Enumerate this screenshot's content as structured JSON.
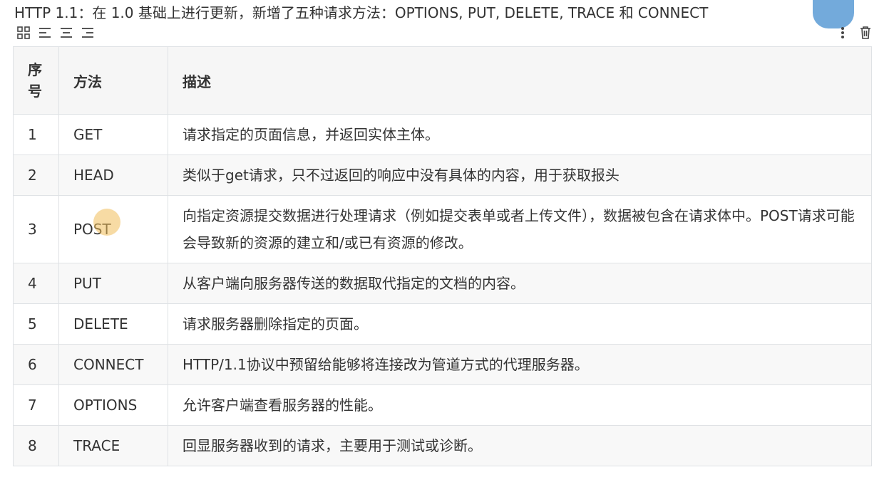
{
  "intro_text": "HTTP 1.1：在 1.0 基础上进行更新，新增了五种请求方法：OPTIONS, PUT, DELETE, TRACE 和 CONNECT",
  "toolbar": {
    "left_icons": [
      "table-grid-icon",
      "align-left-icon",
      "align-center-icon",
      "align-right-icon"
    ],
    "right_icons": [
      "more-vertical-icon",
      "trash-icon"
    ]
  },
  "table": {
    "headers": {
      "seq": "序号",
      "method": "方法",
      "desc": "描述"
    },
    "rows": [
      {
        "seq": "1",
        "method": "GET",
        "desc": "请求指定的页面信息，并返回实体主体。"
      },
      {
        "seq": "2",
        "method": "HEAD",
        "desc": "类似于get请求，只不过返回的响应中没有具体的内容，用于获取报头"
      },
      {
        "seq": "3",
        "method": "POST",
        "desc": "向指定资源提交数据进行处理请求（例如提交表单或者上传文件），数据被包含在请求体中。POST请求可能会导致新的资源的建立和/或已有资源的修改。"
      },
      {
        "seq": "4",
        "method": "PUT",
        "desc": "从客户端向服务器传送的数据取代指定的文档的内容。"
      },
      {
        "seq": "5",
        "method": "DELETE",
        "desc": "请求服务器删除指定的页面。"
      },
      {
        "seq": "6",
        "method": "CONNECT",
        "desc": "HTTP/1.1协议中预留给能够将连接改为管道方式的代理服务器。"
      },
      {
        "seq": "7",
        "method": "OPTIONS",
        "desc": "允许客户端查看服务器的性能。"
      },
      {
        "seq": "8",
        "method": "TRACE",
        "desc": "回显服务器收到的请求，主要用于测试或诊断。"
      }
    ]
  }
}
